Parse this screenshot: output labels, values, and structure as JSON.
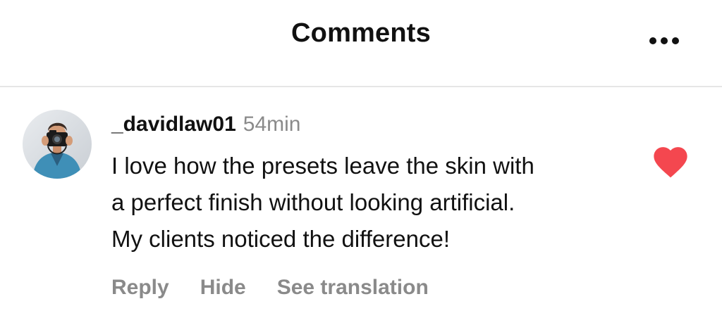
{
  "header": {
    "title": "Comments",
    "more_icon": "more-horizontal-icon"
  },
  "comment": {
    "avatar_icon": "user-avatar-photographer",
    "username": "_davidlaw01",
    "time": "54min",
    "lines": [
      "I love how the presets leave the skin with",
      "a perfect finish without looking artificial.",
      "My clients noticed the difference!"
    ],
    "actions": {
      "reply": "Reply",
      "hide": "Hide",
      "translate": "See translation"
    },
    "liked": true,
    "like_icon": "heart-icon",
    "like_color": "#f4474f"
  },
  "colors": {
    "text_primary": "#111111",
    "text_secondary": "#8a8a8a",
    "divider": "#e6e6e6",
    "background": "#ffffff"
  }
}
